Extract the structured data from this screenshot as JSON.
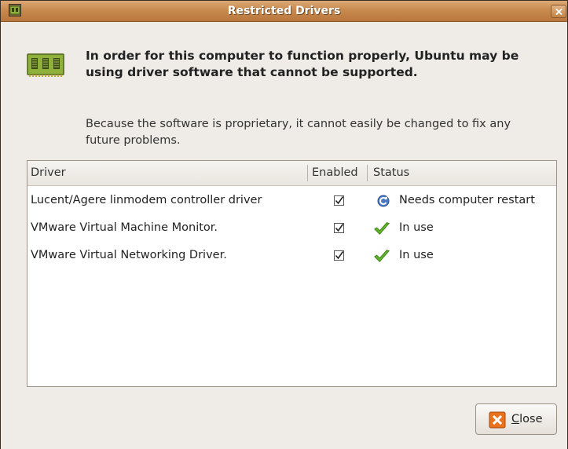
{
  "window": {
    "title": "Restricted Drivers"
  },
  "message": {
    "headline": "In order for this computer to function properly, Ubuntu may be using driver software that cannot be supported.",
    "detail": "Because the software is proprietary, it cannot easily be changed to fix any future problems."
  },
  "table": {
    "columns": {
      "driver": "Driver",
      "enabled": "Enabled",
      "status": "Status"
    },
    "rows": [
      {
        "driver": "Lucent/Agere linmodem controller driver",
        "enabled": true,
        "status": "Needs computer restart",
        "status_icon": "restart-icon"
      },
      {
        "driver": "VMware Virtual Machine Monitor.",
        "enabled": true,
        "status": "In use",
        "status_icon": "checkmark-icon"
      },
      {
        "driver": "VMware Virtual Networking Driver.",
        "enabled": true,
        "status": "In use",
        "status_icon": "checkmark-icon"
      }
    ]
  },
  "buttons": {
    "close_label": "Close"
  },
  "colors": {
    "titlebar": "#c88a4f",
    "background": "#efebe7",
    "ok_green": "#5fb62a",
    "close_orange": "#e8731c"
  }
}
